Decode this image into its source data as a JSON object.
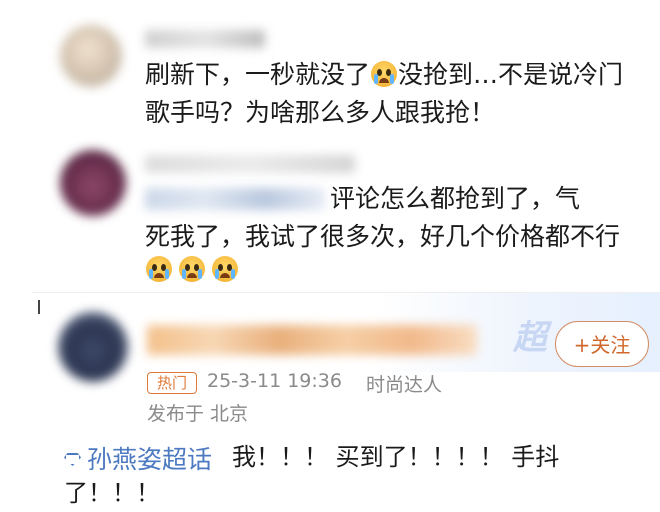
{
  "comments": [
    {
      "text": "刷新下，一秒就没了😭没抢到…不是说冷门歌手吗？为啥那么多人跟我抢！",
      "line1": "刷新下，一秒就没了",
      "line1b": "没抢到…不是说冷门",
      "line2": "歌手吗？为啥那么多人跟我抢！"
    },
    {
      "text": "评论怎么都抢到了，气死我了，我试了很多次，好几个价格都不行😭😭😭",
      "line1": "评论怎么都抢到了，气",
      "line2": "死我了，我试了很多次，好几个价格都不行"
    }
  ],
  "post": {
    "follow_label": "+关注",
    "badge": "热门",
    "timestamp": "25-3-11 19:36",
    "role": "时尚达人",
    "location": "发布于 北京",
    "supertopic": "孙燕姿超话",
    "text_line1": "我！！！ 买到了！！！！ 手抖",
    "text_line2": "了！！！"
  },
  "icons": {
    "crying_emoji": "crying-face-icon",
    "supertopic": "diamond-icon"
  },
  "colors": {
    "accent_orange": "#d0682e",
    "link_blue": "#4d79c1",
    "meta_gray": "#8a8a8a"
  }
}
